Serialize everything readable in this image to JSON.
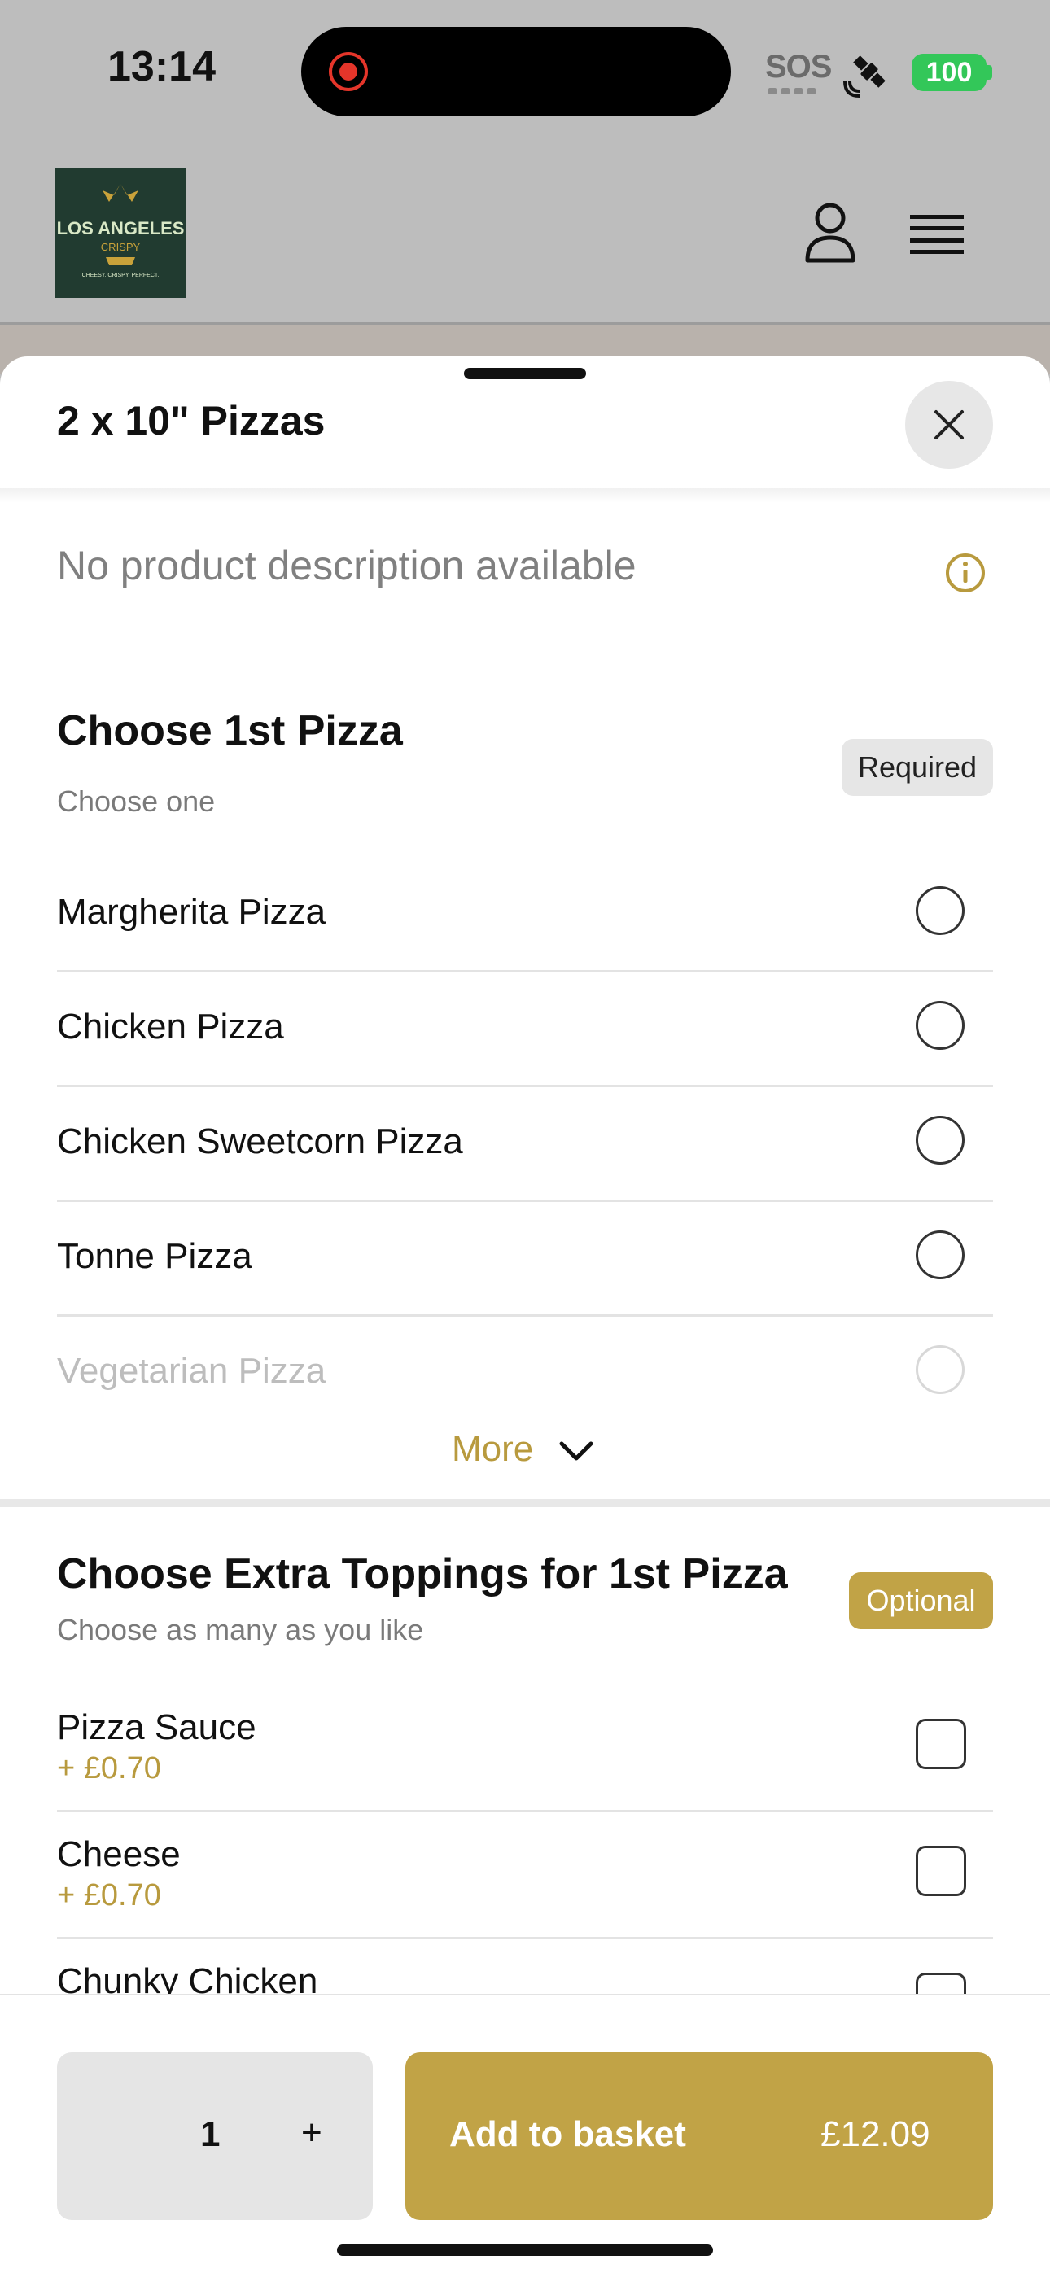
{
  "status_bar": {
    "time": "13:14",
    "sos": "SOS",
    "battery": "100",
    "icons": [
      "recording-indicator-icon",
      "satellite-icon",
      "battery-icon"
    ]
  },
  "header": {
    "logo": {
      "line1": "LOS ANGELES",
      "line2": "CRISPY",
      "tagline": "CHEESY. CRISPY. PERFECT."
    },
    "icons": [
      "user-icon",
      "menu-icon"
    ]
  },
  "sheet": {
    "title": "2 x 10\" Pizzas",
    "description": "No product description available",
    "section1": {
      "title": "Choose 1st Pizza",
      "subtitle": "Choose one",
      "badge": "Required",
      "options": [
        "Margherita Pizza",
        "Chicken Pizza",
        "Chicken Sweetcorn Pizza",
        "Tonne Pizza",
        "Vegetarian Pizza"
      ],
      "more_label": "More"
    },
    "section2": {
      "title": "Choose Extra Toppings for 1st Pizza",
      "subtitle": "Choose as many as you like",
      "badge": "Optional",
      "toppings": [
        {
          "name": "Pizza Sauce",
          "price": "+ £0.70"
        },
        {
          "name": "Cheese",
          "price": "+ £0.70"
        },
        {
          "name": "Chunky Chicken",
          "price": ""
        }
      ]
    }
  },
  "footer": {
    "quantity": "1",
    "plus_label": "+",
    "add_label": "Add to basket",
    "price": "£12.09"
  },
  "colors": {
    "accent": "#c1a346",
    "accent_text": "#b89a3e",
    "battery": "#33c759"
  }
}
